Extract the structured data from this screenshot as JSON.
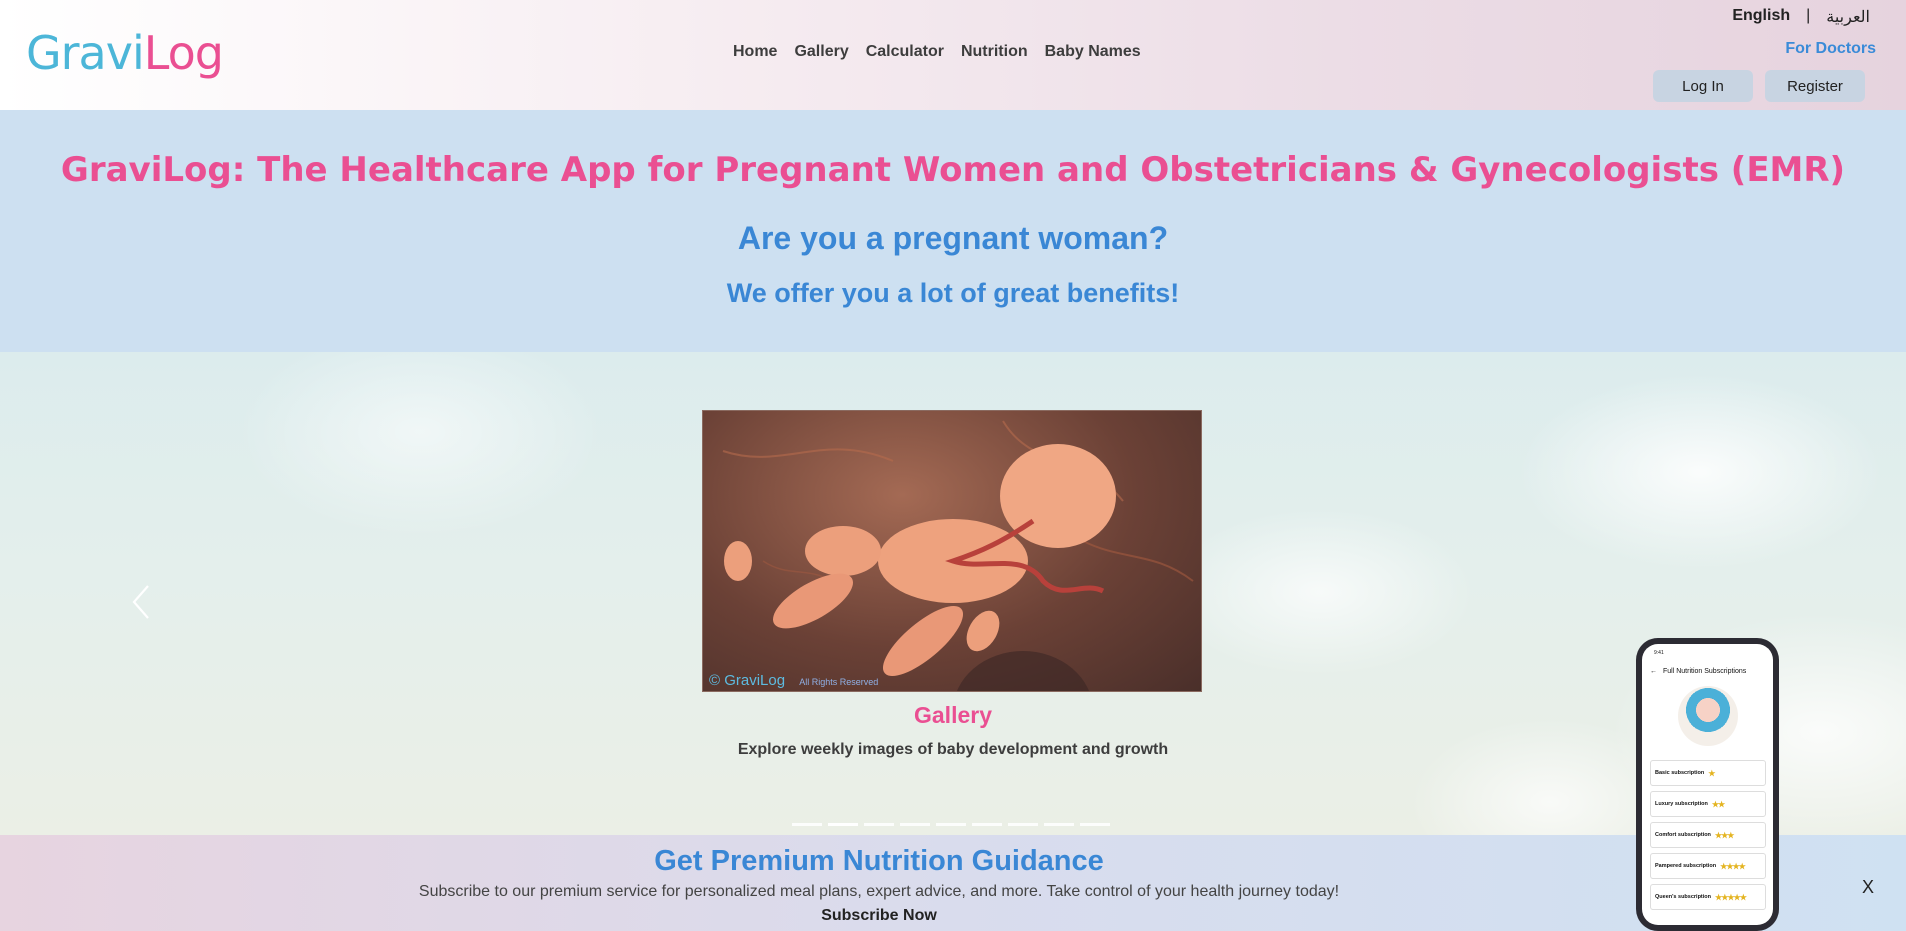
{
  "header": {
    "logo_left": "Gravi",
    "logo_right": "Log",
    "nav": [
      "Home",
      "Gallery",
      "Calculator",
      "Nutrition",
      "Baby Names"
    ],
    "lang_en": "English",
    "lang_sep": "|",
    "lang_ar": "العربية",
    "for_doctors": "For Doctors",
    "login": "Log In",
    "register": "Register"
  },
  "hero": {
    "title": "GraviLog: The Healthcare App for Pregnant Women and Obstetricians & Gynecologists (EMR)",
    "question": "Are you a pregnant woman?",
    "subtitle": "We offer you a lot of great benefits!"
  },
  "carousel": {
    "image_watermark": "© GraviLog",
    "image_rights": "All Rights Reserved",
    "slide_title": "Gallery",
    "slide_text": "Explore weekly images of baby development and growth",
    "indicator_count": 9,
    "active_index": 1
  },
  "premium": {
    "title": "Get Premium Nutrition Guidance",
    "text": "Subscribe to our premium service for personalized meal plans, expert advice, and more. Take control of your health journey today!",
    "cta": "Subscribe Now",
    "close": "X"
  },
  "phone": {
    "status_time": "9:41",
    "screen_title": "Full Nutrition Subscriptions",
    "subscriptions": [
      {
        "name": "Basic subscription",
        "stars": "★"
      },
      {
        "name": "Luxury subscription",
        "stars": "★★"
      },
      {
        "name": "Comfort subscription",
        "stars": "★★★"
      },
      {
        "name": "Pampered subscription",
        "stars": "★★★★"
      },
      {
        "name": "Queen's subscription",
        "stars": "★★★★★"
      }
    ]
  }
}
